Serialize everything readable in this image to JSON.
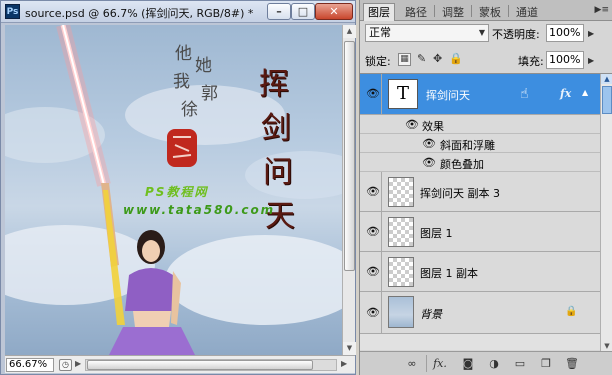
{
  "document": {
    "title": "source.psd @ 66.7% (挥剑问天, RGB/8#) *",
    "app_icon": "Ps",
    "zoom": "66.67%",
    "artwork": {
      "calligraphy": [
        "挥",
        "剑",
        "问",
        "天"
      ],
      "small_chars": [
        "他",
        "她",
        "我",
        "郭",
        "徐"
      ],
      "watermark_1": "PS教程网",
      "watermark_2": "www.tata580.com"
    }
  },
  "panel": {
    "tabs": [
      "图层",
      "路径",
      "调整",
      "蒙板",
      "通道"
    ],
    "active_tab": "图层",
    "blend_mode": "正常",
    "opacity_label": "不透明度:",
    "opacity_value": "100%",
    "lock_label": "锁定:",
    "fill_label": "填充:",
    "fill_value": "100%",
    "layers": [
      {
        "name": "挥剑问天",
        "type": "text",
        "selected": true,
        "fx": "fx"
      },
      {
        "name": "效果",
        "type": "effects-header"
      },
      {
        "name": "斜面和浮雕",
        "type": "effect"
      },
      {
        "name": "颜色叠加",
        "type": "effect"
      },
      {
        "name": "挥剑问天 副本 3",
        "type": "raster"
      },
      {
        "name": "图层 1",
        "type": "raster"
      },
      {
        "name": "图层 1 副本",
        "type": "raster"
      },
      {
        "name": "背景",
        "type": "background",
        "locked": true
      }
    ],
    "text_thumb": "T"
  },
  "icons": {
    "eye": "eye-icon",
    "link": "link-layers-icon",
    "fx": "add-layer-style-icon",
    "mask": "add-mask-icon",
    "adjust": "adjustment-layer-icon",
    "folder": "new-group-icon",
    "new": "new-layer-icon",
    "trash": "delete-layer-icon"
  },
  "colors": {
    "selection": "#3d8ee0",
    "calligraphy": "#5a1a12",
    "watermark": "#3d9a1a"
  }
}
